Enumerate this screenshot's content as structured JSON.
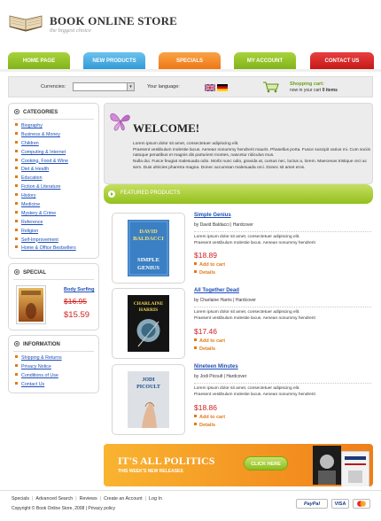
{
  "header": {
    "title": "BOOK ONLINE STORE",
    "tagline": "the biggest choice"
  },
  "nav": [
    {
      "label": "HOME PAGE",
      "color": "#8cbd1c"
    },
    {
      "label": "NEW PRODUCTS",
      "color": "#3aa6de"
    },
    {
      "label": "SPECIALS",
      "color": "#f07e18"
    },
    {
      "label": "MY ACCOUNT",
      "color": "#8cbd1c"
    },
    {
      "label": "CONTACT US",
      "color": "#d21b1b"
    }
  ],
  "toolbar": {
    "currencies_label": "Currencies:",
    "currency_value": "",
    "language_label": "Your language:",
    "languages": [
      "English",
      "German"
    ],
    "cart_title": "Shopping cart:",
    "cart_prefix": "now in your cart",
    "cart_count": "0 items"
  },
  "categories": {
    "heading": "CATEGORIES",
    "items": [
      "Biography",
      "Business & Money",
      "Children",
      "Computing & Internet",
      "Cooking, Food & Wine",
      "Diet & Health",
      "Education",
      "Fiction & Literature",
      "History",
      "Medicine",
      "Mystery & Crime",
      "Reference",
      "Religion",
      "Self-Improvement",
      "Home & Office Bestsellers"
    ]
  },
  "special": {
    "heading": "SPECIAL",
    "title": "Body Surfing",
    "old_price": "$16.95",
    "new_price": "$15.59"
  },
  "information": {
    "heading": "INFORMATION",
    "items": [
      "Shipping & Returns",
      "Privacy Notice",
      "Conditions of Use",
      "Contact Us"
    ]
  },
  "welcome": {
    "title": "WELCOME!",
    "para1": "Lorem ipsum dolor sit amet, consectetuer adipiscing elit.",
    "para2": "Praesent vestibulum molestie lacus. Aenean nonummy hendrerit mauris. Phasellus porta. Fusce suscipit varius mi. Cum sociis natoque penatibus et magnis dis parturient montes, nascetur ridiculus mus.",
    "para3": "Nulla dui. Fusce feugiat malesuada odio. Morbi nunc odio, gravida at, cursus nec, luctus a, lorem. Maecenas tristique orci ac sem. Duis ultricies pharetra magna. Donec accumsan malesuada orci. Donec sit amet eros."
  },
  "featured_label": "FEATURED PRODUCTS",
  "products": [
    {
      "title": "Simple Genius",
      "author": "by David Baldacci | Hardcover",
      "desc1": "Lorem ipsum dolor sit amet, consectetuer adipiscing elit.",
      "desc2": "Praesent vestibulum molestie lacus. Aenean nonummy hendrerit",
      "price": "$18.89",
      "cart": "Add to cart",
      "details": "Details",
      "cover_top": "DAVID BALDACCI",
      "cover_bottom": "SIMPLE GENIUS",
      "cover_color": "#3b7fc4"
    },
    {
      "title": "All Together Dead",
      "author": "by Charlaine Harris | Hardcover",
      "desc1": "Lorem ipsum dolor sit amet, consectetuer adipiscing elit.",
      "desc2": "Praesent vestibulum molestie lacus. Aenean nonummy hendrerit",
      "price": "$17.46",
      "cart": "Add to cart",
      "details": "Details",
      "cover_top": "CHARLAINE HARRIS",
      "cover_bottom": "",
      "cover_color": "#1a1a1a"
    },
    {
      "title": "Nineteen Minutes",
      "author": "by Jodi Picoult | Hardcover",
      "desc1": "Lorem ipsum dolor sit amet, consectetuer adipiscing elit.",
      "desc2": "Praesent vestibulum molestie lacus. Aenean nonummy hendrerit",
      "price": "$18.86",
      "cart": "Add to cart",
      "details": "Details",
      "cover_top": "JODI PICOULT",
      "cover_bottom": "",
      "cover_color": "#d9dde3"
    }
  ],
  "banner": {
    "title": "IT'S ALL POLITICS",
    "subtitle": "THIS WEEK'S NEW RELEASES",
    "button": "CLICK HERE"
  },
  "footer": {
    "links": [
      "Specials",
      "Advanced Search",
      "Reviews",
      "Create an Account",
      "Log In"
    ],
    "copyright": "Copyright © Book Online Store, 2008 | Privacy policy",
    "payments": [
      "PayPal",
      "VISA",
      "MasterCard"
    ]
  }
}
